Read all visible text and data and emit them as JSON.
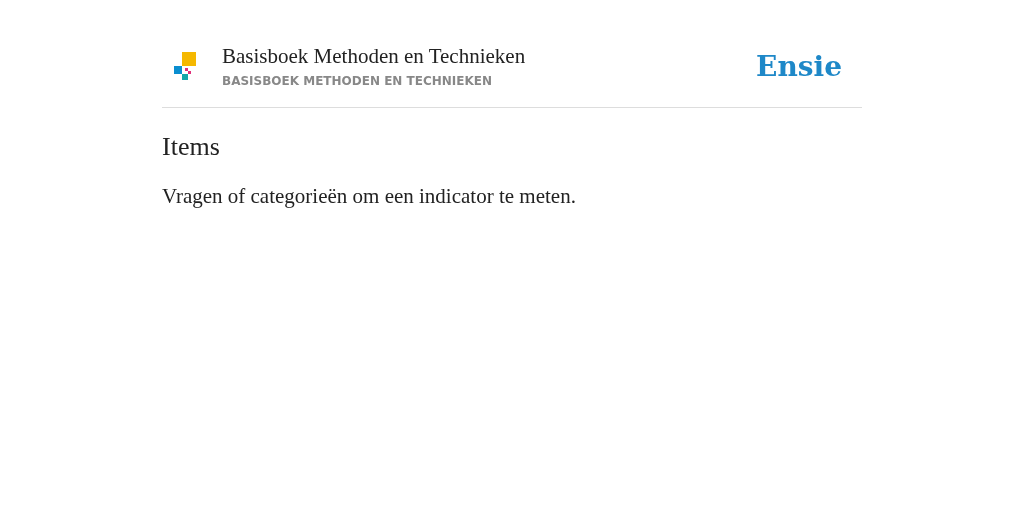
{
  "header": {
    "title": "Basisboek Methoden en Technieken",
    "subtitle": "BASISBOEK METHODEN EN TECHNIEKEN",
    "brand": "Ensie"
  },
  "entry": {
    "heading": "Items",
    "definition": "Vragen of categorieën om een indicator te meten."
  }
}
